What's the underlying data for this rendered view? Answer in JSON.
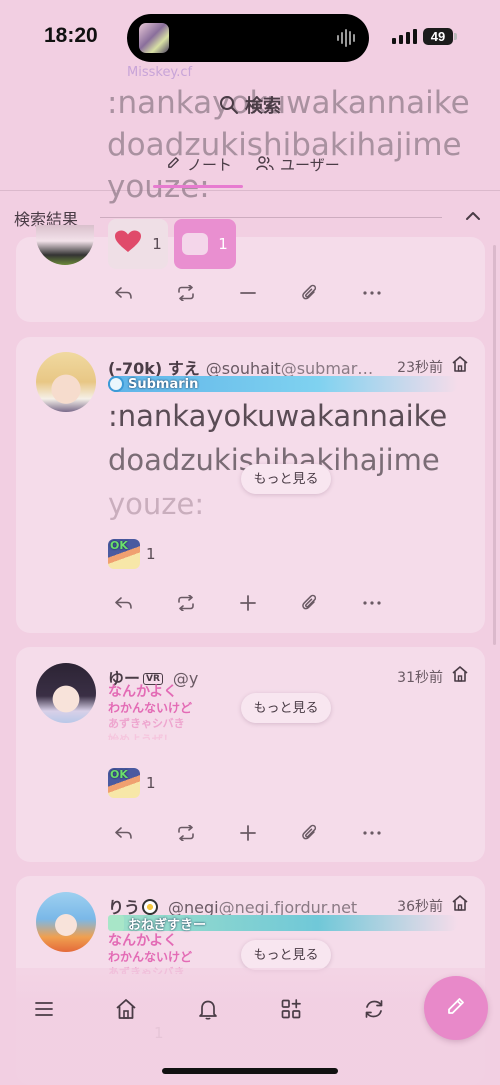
{
  "status_bar": {
    "time": "18:20",
    "battery": "49"
  },
  "header": {
    "title": "検索",
    "tabs": [
      {
        "label": "ノート",
        "active": true
      },
      {
        "label": "ユーザー",
        "active": false
      }
    ],
    "results_label": "検索結果",
    "ghost_banner": "Misskey.cf",
    "ghost_lines": [
      ":nankayokuwakannaike",
      "doadzukishibakihajime",
      "youze:"
    ],
    "ghost_more": "もっと見る"
  },
  "notes": [
    {
      "reactions": [
        {
          "emoji": "heart-icon",
          "count": "1"
        },
        {
          "emoji": "custom-emoji",
          "count": "1"
        }
      ],
      "actions": [
        "reply-icon",
        "renote-icon",
        "minus-icon",
        "clip-icon",
        "more-icon"
      ]
    },
    {
      "display_name": "(-70k) すえ",
      "handle": "@souhait",
      "host": "@submar…",
      "time": "23秒前",
      "banner": "Submarin",
      "text_lines": [
        ":nankayokuwakannaike",
        "doadzukishibakihajime",
        "youze:"
      ],
      "more": "もっと見る",
      "reaction_count": "1",
      "reaction_emoji": "OK"
    },
    {
      "display_name": "ゆー",
      "badge": "VR",
      "handle": "@y",
      "time": "31秒前",
      "text_lines": [
        "なんかよく",
        "わかんないけど",
        "あずきゃシバき",
        "始めようぜ！"
      ],
      "more": "もっと見る",
      "reaction_count": "1",
      "reaction_emoji": "OK"
    },
    {
      "display_name": "りう",
      "handle": "@negi",
      "host": "@negi.fjordur.net",
      "time": "36秒前",
      "banner": "おねぎすきー",
      "text_lines": [
        "なんかよく",
        "わかんないけど",
        "あずきゃシバき"
      ],
      "more": "もっと見る",
      "reaction_count": "1"
    }
  ],
  "bottom_nav": [
    "menu-icon",
    "home-icon",
    "bell-icon",
    "widgets-icon",
    "refresh-icon",
    "compose-icon"
  ],
  "colors": {
    "background": "#f2cfe2",
    "card": "#f5dcea",
    "accent": "#e77bd0",
    "fab": "#e889c9"
  }
}
